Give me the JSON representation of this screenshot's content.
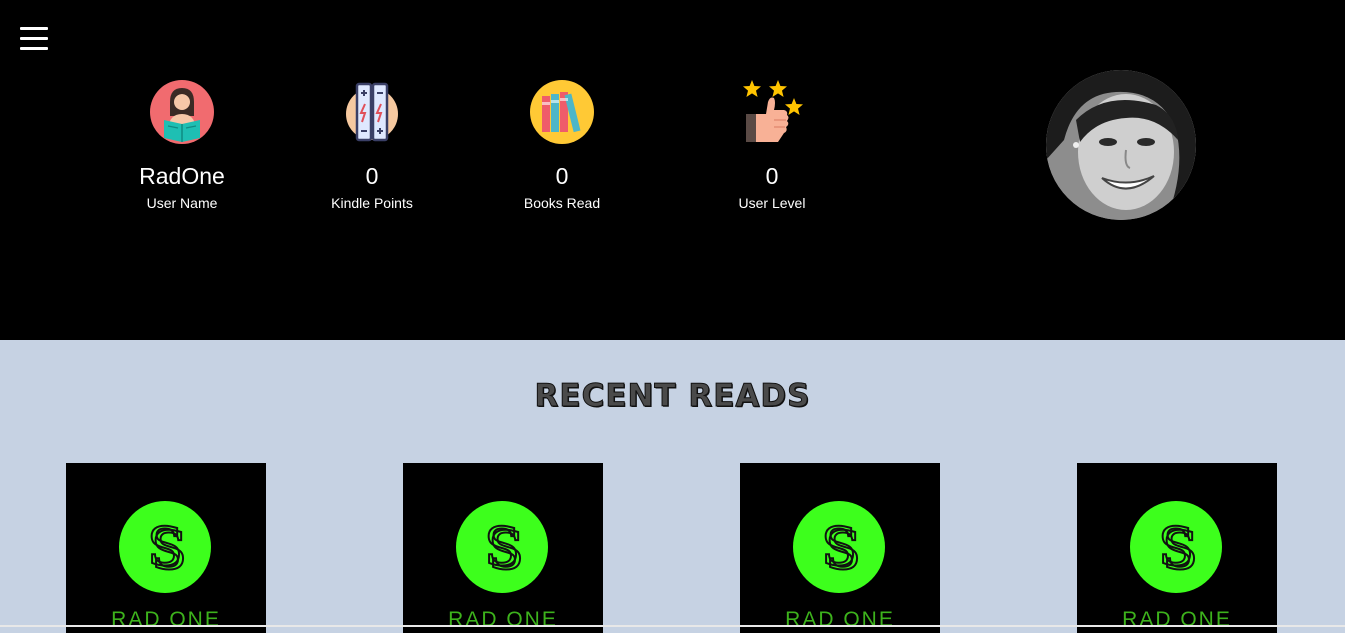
{
  "menu": {
    "icon": "hamburger-menu-icon"
  },
  "stats": [
    {
      "icon": "reader-icon",
      "value": "RadOne",
      "label": "User Name"
    },
    {
      "icon": "battery-icon",
      "value": "0",
      "label": "Kindle Points"
    },
    {
      "icon": "books-icon",
      "value": "0",
      "label": "Books Read"
    },
    {
      "icon": "thumbs-up-stars-icon",
      "value": "0",
      "label": "User Level"
    }
  ],
  "profile": {
    "icon": "profile-photo"
  },
  "recent": {
    "title": "RECENT READS",
    "books": [
      {
        "brand": "RAD ONE",
        "logo_letter": "S"
      },
      {
        "brand": "RAD ONE",
        "logo_letter": "S"
      },
      {
        "brand": "RAD ONE",
        "logo_letter": "S"
      },
      {
        "brand": "RAD ONE",
        "logo_letter": "S"
      }
    ]
  },
  "colors": {
    "header_bg": "#000000",
    "content_bg": "#c6d2e3",
    "logo_green": "#3dff1c",
    "brand_text": "#3db21c"
  }
}
